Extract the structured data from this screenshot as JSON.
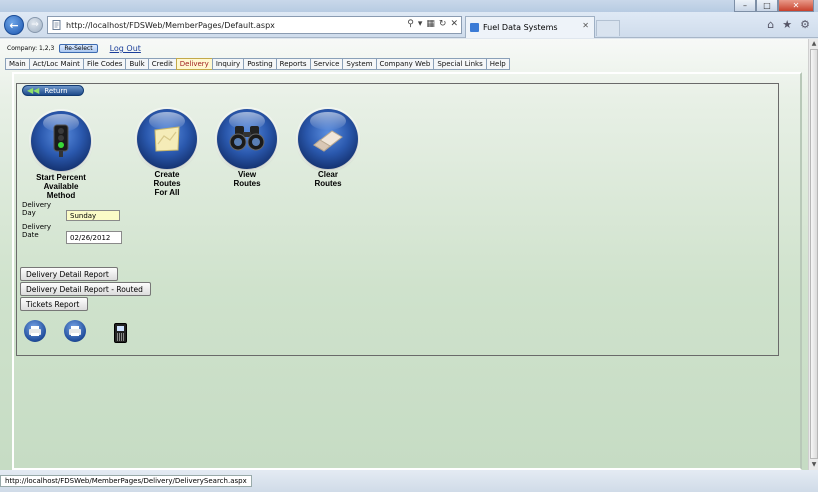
{
  "browser": {
    "address": "http://localhost/FDSWeb/MemberPages/Default.aspx",
    "tab_title": "Fuel Data Systems",
    "status_url": "http://localhost/FDSWeb/MemberPages/Delivery/DeliverySearch.aspx"
  },
  "header": {
    "company_label": "Company: 1,2,3",
    "reselect_label": "Re-Select",
    "logout_label": "Log Out"
  },
  "menu": {
    "items": [
      "Main",
      "Act/Loc Maint",
      "File Codes",
      "Bulk",
      "Credit",
      "Delivery",
      "Inquiry",
      "Posting",
      "Reports",
      "Service",
      "System",
      "Company Web",
      "Special Links",
      "Help"
    ],
    "active": "Delivery"
  },
  "panel": {
    "return_label": "Return",
    "actions": [
      {
        "label_lines": [
          "Start Percent",
          "Available",
          "Method"
        ],
        "icon": "traffic-light-icon"
      },
      {
        "label_lines": [
          "Create",
          "Routes",
          "For All"
        ],
        "icon": "map-icon"
      },
      {
        "label_lines": [
          "View",
          "Routes"
        ],
        "icon": "binoculars-icon"
      },
      {
        "label_lines": [
          "Clear",
          "Routes"
        ],
        "icon": "eraser-icon"
      }
    ],
    "delivery_day_label_1": "Delivery",
    "delivery_day_label_2": "Day",
    "delivery_day_value": "Sunday",
    "delivery_date_label_1": "Delivery",
    "delivery_date_label_2": "Date",
    "delivery_date_value": "02/26/2012",
    "reports": [
      "Delivery Detail Report",
      "Delivery Detail Report - Routed",
      "Tickets Report"
    ],
    "bottom_icons": [
      "printer-icon",
      "printer-icon",
      "handheld-device-icon"
    ]
  },
  "colors": {
    "page_gradient_top": "#f7f9f7",
    "page_gradient_bottom": "#c6dcc4",
    "orb_blue": "#2a58ad",
    "active_tab": "#fff8d0"
  }
}
